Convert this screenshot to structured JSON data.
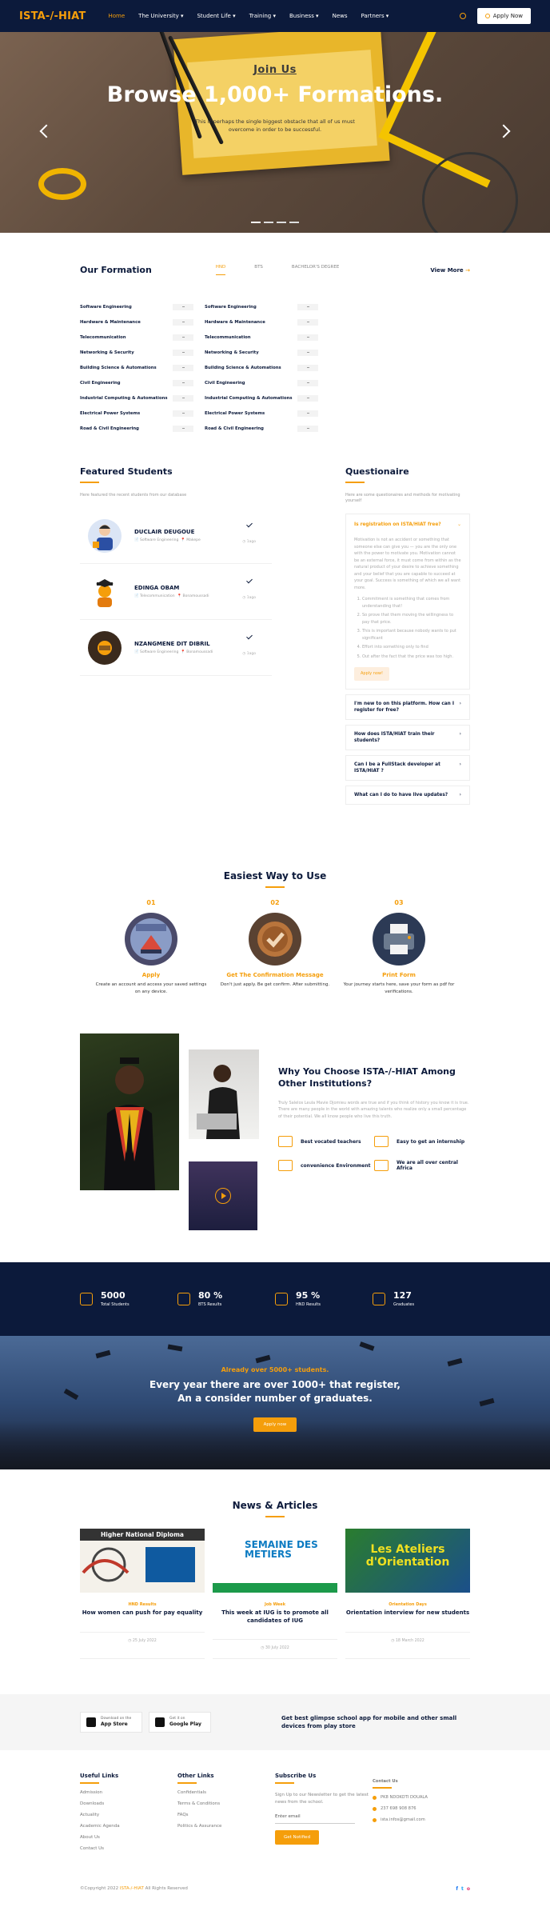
{
  "nav": {
    "logo": "ISTA-/-HIAT",
    "items": [
      {
        "label": "Home"
      },
      {
        "label": "The University ▾"
      },
      {
        "label": "Student Life ▾"
      },
      {
        "label": "Training ▾"
      },
      {
        "label": "Business ▾"
      },
      {
        "label": "News"
      },
      {
        "label": "Partners ▾"
      }
    ],
    "apply_label": "Apply Now"
  },
  "hero": {
    "join": "Join Us",
    "title": "Browse 1,000+ Formations.",
    "subtitle": "This is perhaps the single biggest obstacle that all of us must overcome in order to be successful.",
    "slides": 4
  },
  "formation": {
    "title": "Our Formation",
    "tabs": [
      {
        "label": "HND"
      },
      {
        "label": "BTS"
      },
      {
        "label": "BACHELOR'S DEGREE"
      }
    ],
    "view_more": "View More",
    "col1": [
      "Software Engineering",
      "Hardware & Maintenance",
      "Telecommunication",
      "Networking & Security",
      "Building Science & Automations",
      "Civil Engineering",
      "Industrial Computing & Automations",
      "Electrical Power Systems",
      "Road & Civil Engineering"
    ],
    "col2": [
      "Software Engineering",
      "Hardware & Maintenance",
      "Telecommunication",
      "Networking & Security",
      "Building Science & Automations",
      "Civil Engineering",
      "Industrial Computing & Automations",
      "Electrical Power Systems",
      "Road & Civil Engineering"
    ]
  },
  "featured": {
    "title": "Featured Students",
    "lead": "Here featured the recent students from our database",
    "students": [
      {
        "name": "DUCLAIR DEUGOUE",
        "field": "Software Engineering",
        "place": "Makepe",
        "ago": "1ago"
      },
      {
        "name": "EDINGA OBAM",
        "field": "Telecommunication",
        "place": "Bonamoussadi",
        "ago": "1ago"
      },
      {
        "name": "NZANGMENE DIT DIBRIL",
        "field": "Software Engineering",
        "place": "Bonamoussadi",
        "ago": "1ago"
      }
    ]
  },
  "questionnaire": {
    "title": "Questionaire",
    "lead": "Here are some questionaires and methods for motivating yourself",
    "open": {
      "question": "Is registration on ISTA/HIAT free?",
      "answer": "Motivation is not an accident or something that someone else can give you — you are the only one with the power to motivate you. Motivation cannot be an external force, it must come from within as the natural product of your desire to achieve something and your belief that you are capable to succeed at your goal. Success is something of which we all want more.",
      "list": [
        "Commitment is something that comes from understanding that!",
        "So prove that them moving the willingness to pay that price.",
        "This is important because nobody wants to put significant",
        "Effort into something only to find",
        "Out after the fact that the price was too high."
      ],
      "button": "Apply now!"
    },
    "items": [
      {
        "q": "I'm new to on this platform. How can I register for free?"
      },
      {
        "q": "How does ISTA/HIAT train their students?"
      },
      {
        "q": "Can I be a FullStack developer at ISTA/HIAT ?"
      },
      {
        "q": "What can I do to have live updates?"
      }
    ]
  },
  "easiest": {
    "title": "Easiest Way to Use",
    "steps": [
      {
        "num": "01",
        "name": "Apply",
        "desc": "Create an account and access your saved settings on any device."
      },
      {
        "num": "02",
        "name": "Get The Confirmation Message",
        "desc": "Don't just apply. Be get confirm. After submitting."
      },
      {
        "num": "03",
        "name": "Print Form",
        "desc": "Your journey starts here, save your form as pdf for verifications."
      }
    ]
  },
  "why": {
    "title": "Why You Choose ISTA-/-HIAT Among Other Institutions?",
    "desc": "Truly Salelos Leula Mavie Djomieu words are true and if you think of history you know it is true. There are many people in the world with amazing talents who realize only a small percentage of their potential. We all know people who live this truth.",
    "features": [
      {
        "label": "Best vocated teachers"
      },
      {
        "label": "Easy to get an internship"
      },
      {
        "label": "convenience Environment"
      },
      {
        "label": "We are all over central Africa"
      }
    ]
  },
  "stats": [
    {
      "value": "5000",
      "label": "Total Students"
    },
    {
      "value": "80 %",
      "label": "BTS Results"
    },
    {
      "value": "95 %",
      "label": "HND Results"
    },
    {
      "value": "127",
      "label": "Graduates"
    }
  ],
  "banner": {
    "sub": "Already over 5000+ students.",
    "title": "Every year there are over 1000+ that register, An a consider number of graduates.",
    "button": "Apply now"
  },
  "news": {
    "title": "News & Articles",
    "cards": [
      {
        "tag": "HND Results",
        "title": "How women can push for pay equality",
        "date": "25 July 2022",
        "img_text": "Higher National Diploma"
      },
      {
        "tag": "Job Week",
        "title": "This week at IUG is to promote all candidates of IUG",
        "date": "30 July 2022",
        "img_text": "SEMAINE DES METIERS"
      },
      {
        "tag": "Orientation Days",
        "title": "Orientation interview for new students",
        "date": "18 March 2022",
        "img_text": "Les Ateliers d'Orientation"
      }
    ]
  },
  "app": {
    "appstore_small": "Download on the",
    "appstore": "App Store",
    "play_small": "Get it on",
    "play": "Google Play",
    "text": "Get best glimpse school app for mobile and other small devices from play store"
  },
  "footer": {
    "useful": {
      "title": "Useful Links",
      "links": [
        "Admission",
        "Downloads",
        "Actuality",
        "Academic Agenda",
        "About Us",
        "Contact Us"
      ]
    },
    "other": {
      "title": "Other Links",
      "links": [
        "Confidentials",
        "Terms & Conditions",
        "FAQs",
        "Politics & Assurance"
      ]
    },
    "subscribe": {
      "title": "Subscribe Us",
      "desc": "Sign Up to our Newsletter to get the latest news from the school.",
      "placeholder": "Enter email",
      "button": "Get Notified"
    },
    "contact": {
      "title": "Contact Us",
      "items": [
        "PK8 NDOKOTI DOUALA",
        "237 698 908 876",
        "ista.infos@gmail.com"
      ]
    },
    "copy_pre": "©Copyright 2022 ",
    "copy_brand": "ISTA-/-HIAT",
    "copy_post": " All Rights Reserved",
    "social": [
      "f",
      "t",
      "o"
    ]
  },
  "colors": {
    "primary": "#0c1a3b",
    "accent": "#f59e0b"
  }
}
